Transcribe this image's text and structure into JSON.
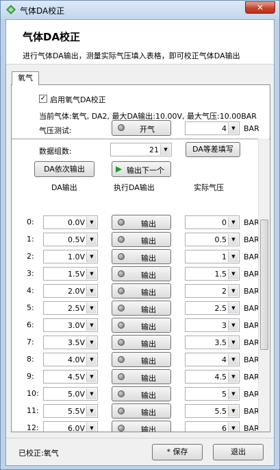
{
  "window": {
    "title": "气体DA校正",
    "close_label": "✕"
  },
  "header": {
    "title": "气体DA校正",
    "description": "进行气体DA输出，测量实际气压填入表格，即可校正气体DA输出"
  },
  "tab": {
    "label": "氧气"
  },
  "enable": {
    "label": "启用氧气DA校正",
    "checked": true,
    "mark": "✓"
  },
  "current_info": "当前气体:氧气, DA2, 最大DA输出:10.00V, 最大气压:10.00BAR",
  "pressure_test": {
    "label": "气压测试:",
    "button_label": "开气",
    "value": "4",
    "unit": "BAR"
  },
  "group": {
    "label": "数据组数:",
    "value": "21",
    "fill_button": "DA等差填写"
  },
  "controls": {
    "output_seq_button": "DA依次输出",
    "output_next_button": "输出下一个",
    "play_icon": "▶"
  },
  "columns": [
    "DA输出",
    "执行DA输出",
    "实际气压"
  ],
  "row_button_label": "输出",
  "unit": "BAR",
  "arrow": "▼",
  "rows": [
    {
      "index": "0:",
      "da": "0.0V",
      "pressure": "0"
    },
    {
      "index": "1:",
      "da": "0.5V",
      "pressure": "0.5"
    },
    {
      "index": "2:",
      "da": "1.0V",
      "pressure": "1"
    },
    {
      "index": "3:",
      "da": "1.5V",
      "pressure": "1.5"
    },
    {
      "index": "4:",
      "da": "2.0V",
      "pressure": "2"
    },
    {
      "index": "5:",
      "da": "2.5V",
      "pressure": "2.5"
    },
    {
      "index": "6:",
      "da": "3.0V",
      "pressure": "3"
    },
    {
      "index": "7:",
      "da": "3.5V",
      "pressure": "3.5"
    },
    {
      "index": "8:",
      "da": "4.0V",
      "pressure": "4"
    },
    {
      "index": "9:",
      "da": "4.5V",
      "pressure": "4.5"
    },
    {
      "index": "10:",
      "da": "5.0V",
      "pressure": "5"
    },
    {
      "index": "11:",
      "da": "5.5V",
      "pressure": "5.5"
    },
    {
      "index": "12:",
      "da": "6.0V",
      "pressure": "6"
    },
    {
      "index": "13:",
      "da": "",
      "pressure": ""
    }
  ],
  "footer": {
    "status": "已校正:氧气",
    "save_button": "* 保存",
    "exit_button": "退出"
  }
}
